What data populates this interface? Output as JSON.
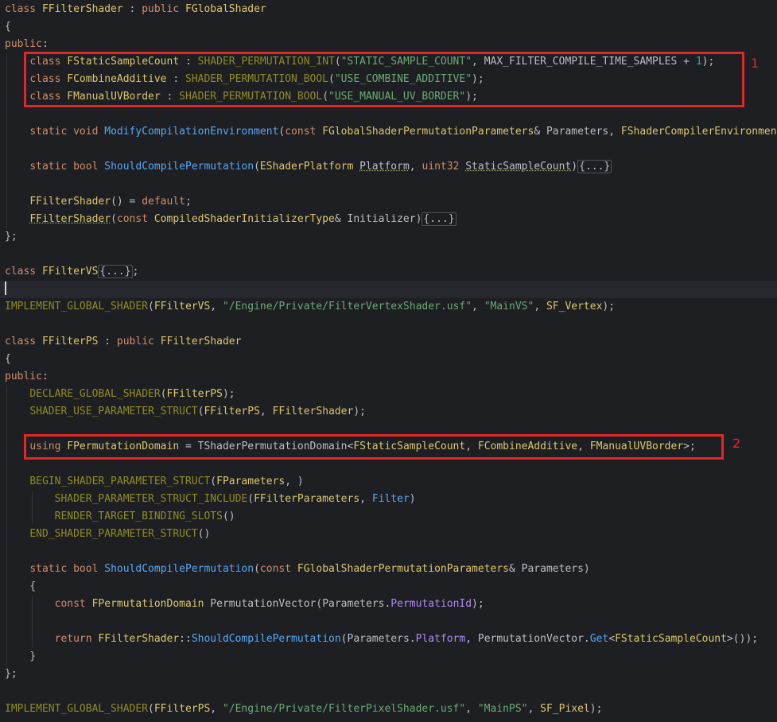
{
  "colors": {
    "background": "#1e1f22",
    "keyword": "#cf8e6d",
    "class_name": "#dcc76e",
    "function_name": "#56a8f5",
    "macro": "#908b25",
    "string": "#6aab73",
    "number": "#2aacb8",
    "parameter": "#b189f5",
    "plain": "#bcbec4",
    "annotation_red": "#e32626"
  },
  "annotations": [
    "1",
    "2"
  ],
  "code_lines": [
    {
      "tokens": [
        {
          "t": "class",
          "c": "kw"
        },
        {
          "t": " "
        },
        {
          "t": "FFilterShader",
          "c": "cls"
        },
        {
          "t": " : "
        },
        {
          "t": "public",
          "c": "kw"
        },
        {
          "t": " "
        },
        {
          "t": "FGlobalShader",
          "c": "cls"
        }
      ]
    },
    {
      "tokens": [
        {
          "t": "{"
        }
      ]
    },
    {
      "tokens": [
        {
          "t": "public",
          "c": "kw"
        },
        {
          "t": ":"
        }
      ]
    },
    {
      "tokens": [
        {
          "t": "    "
        },
        {
          "t": "class",
          "c": "kw"
        },
        {
          "t": " "
        },
        {
          "t": "FStaticSampleCount",
          "c": "cls"
        },
        {
          "t": " : "
        },
        {
          "t": "SHADER_PERMUTATION_INT",
          "c": "mac"
        },
        {
          "t": "("
        },
        {
          "t": "\"STATIC_SAMPLE_COUNT\"",
          "c": "str"
        },
        {
          "t": ", "
        },
        {
          "t": "MAX_FILTER_COMPILE_TIME_SAMPLES"
        },
        {
          "t": " + "
        },
        {
          "t": "1",
          "c": "num"
        },
        {
          "t": ");"
        }
      ]
    },
    {
      "tokens": [
        {
          "t": "    "
        },
        {
          "t": "class",
          "c": "kw"
        },
        {
          "t": " "
        },
        {
          "t": "FCombineAdditive",
          "c": "cls"
        },
        {
          "t": " : "
        },
        {
          "t": "SHADER_PERMUTATION_BOOL",
          "c": "mac"
        },
        {
          "t": "("
        },
        {
          "t": "\"USE_COMBINE_ADDITIVE\"",
          "c": "str"
        },
        {
          "t": ");"
        }
      ]
    },
    {
      "tokens": [
        {
          "t": "    "
        },
        {
          "t": "class",
          "c": "kw"
        },
        {
          "t": " "
        },
        {
          "t": "FManualUVBorder",
          "c": "cls"
        },
        {
          "t": " : "
        },
        {
          "t": "SHADER_PERMUTATION_BOOL",
          "c": "mac"
        },
        {
          "t": "("
        },
        {
          "t": "\"USE_MANUAL_UV_BORDER\"",
          "c": "str"
        },
        {
          "t": ");"
        }
      ]
    },
    {
      "tokens": []
    },
    {
      "tokens": [
        {
          "t": "    "
        },
        {
          "t": "static",
          "c": "kw"
        },
        {
          "t": " "
        },
        {
          "t": "void",
          "c": "kw"
        },
        {
          "t": " "
        },
        {
          "t": "ModifyCompilationEnvironment",
          "c": "fn"
        },
        {
          "t": "("
        },
        {
          "t": "const",
          "c": "kw"
        },
        {
          "t": " "
        },
        {
          "t": "FGlobalShaderPermutationParameters",
          "c": "cls"
        },
        {
          "t": "& Parameters, "
        },
        {
          "t": "FShaderCompilerEnvironment",
          "c": "cls"
        }
      ]
    },
    {
      "tokens": []
    },
    {
      "tokens": [
        {
          "t": "    "
        },
        {
          "t": "static",
          "c": "kw"
        },
        {
          "t": " "
        },
        {
          "t": "bool",
          "c": "kw"
        },
        {
          "t": " "
        },
        {
          "t": "ShouldCompilePermutation",
          "c": "fn"
        },
        {
          "t": "("
        },
        {
          "t": "EShaderPlatform",
          "c": "cls"
        },
        {
          "t": " "
        },
        {
          "t": "Platform",
          "u": true
        },
        {
          "t": ", "
        },
        {
          "t": "uint32",
          "c": "kw"
        },
        {
          "t": " "
        },
        {
          "t": "StaticSampleCount",
          "u": true
        },
        {
          "t": ")"
        },
        {
          "t": "{...}",
          "c": "fold"
        }
      ]
    },
    {
      "tokens": []
    },
    {
      "tokens": [
        {
          "t": "    "
        },
        {
          "t": "FFilterShader",
          "c": "cls"
        },
        {
          "t": "() = "
        },
        {
          "t": "default",
          "c": "kw"
        },
        {
          "t": ";"
        }
      ]
    },
    {
      "tokens": [
        {
          "t": "    "
        },
        {
          "t": "FFilterShader",
          "c": "cls",
          "u": true
        },
        {
          "t": "("
        },
        {
          "t": "const",
          "c": "kw"
        },
        {
          "t": " "
        },
        {
          "t": "CompiledShaderInitializerType",
          "c": "cls"
        },
        {
          "t": "& Initializer)"
        },
        {
          "t": "{...}",
          "c": "fold"
        }
      ]
    },
    {
      "tokens": [
        {
          "t": "};"
        }
      ]
    },
    {
      "tokens": []
    },
    {
      "tokens": [
        {
          "t": "class",
          "c": "kw"
        },
        {
          "t": " "
        },
        {
          "t": "FFilterVS",
          "c": "cls"
        },
        {
          "t": "{...}",
          "c": "fold"
        },
        {
          "t": ";"
        }
      ]
    },
    {
      "tokens": [],
      "current": true
    },
    {
      "tokens": [
        {
          "t": "IMPLEMENT_GLOBAL_SHADER",
          "c": "mac"
        },
        {
          "t": "("
        },
        {
          "t": "FFilterVS",
          "c": "cls"
        },
        {
          "t": ", "
        },
        {
          "t": "\"/Engine/Private/FilterVertexShader.usf\"",
          "c": "str"
        },
        {
          "t": ", "
        },
        {
          "t": "\"MainVS\"",
          "c": "str"
        },
        {
          "t": ", "
        },
        {
          "t": "SF_Vertex",
          "c": "cls"
        },
        {
          "t": ");"
        }
      ]
    },
    {
      "tokens": []
    },
    {
      "tokens": [
        {
          "t": "class",
          "c": "kw"
        },
        {
          "t": " "
        },
        {
          "t": "FFilterPS",
          "c": "cls"
        },
        {
          "t": " : "
        },
        {
          "t": "public",
          "c": "kw"
        },
        {
          "t": " "
        },
        {
          "t": "FFilterShader",
          "c": "cls"
        }
      ]
    },
    {
      "tokens": [
        {
          "t": "{"
        }
      ]
    },
    {
      "tokens": [
        {
          "t": "public",
          "c": "kw"
        },
        {
          "t": ":"
        }
      ]
    },
    {
      "tokens": [
        {
          "t": "    "
        },
        {
          "t": "DECLARE_GLOBAL_SHADER",
          "c": "mac"
        },
        {
          "t": "("
        },
        {
          "t": "FFilterPS",
          "c": "cls"
        },
        {
          "t": ");"
        }
      ]
    },
    {
      "tokens": [
        {
          "t": "    "
        },
        {
          "t": "SHADER_USE_PARAMETER_STRUCT",
          "c": "mac"
        },
        {
          "t": "("
        },
        {
          "t": "FFilterPS",
          "c": "cls"
        },
        {
          "t": ", "
        },
        {
          "t": "FFilterShader",
          "c": "cls"
        },
        {
          "t": ");"
        }
      ]
    },
    {
      "tokens": []
    },
    {
      "tokens": [
        {
          "t": "    "
        },
        {
          "t": "using",
          "c": "kw"
        },
        {
          "t": " "
        },
        {
          "t": "FPermutationDomain",
          "c": "cls"
        },
        {
          "t": " = "
        },
        {
          "t": "TShaderPermutationDomain"
        },
        {
          "t": "<"
        },
        {
          "t": "FStaticSampleCount",
          "c": "cls"
        },
        {
          "t": ", "
        },
        {
          "t": "FCombineAdditive",
          "c": "cls"
        },
        {
          "t": ", "
        },
        {
          "t": "FManualUVBorder",
          "c": "cls"
        },
        {
          "t": ">;"
        }
      ]
    },
    {
      "tokens": []
    },
    {
      "tokens": [
        {
          "t": "    "
        },
        {
          "t": "BEGIN_SHADER_PARAMETER_STRUCT",
          "c": "mac"
        },
        {
          "t": "("
        },
        {
          "t": "FParameters",
          "c": "cls"
        },
        {
          "t": ", )"
        }
      ]
    },
    {
      "tokens": [
        {
          "t": "        "
        },
        {
          "t": "SHADER_PARAMETER_STRUCT_INCLUDE",
          "c": "mac"
        },
        {
          "t": "("
        },
        {
          "t": "FFilterParameters",
          "c": "cls"
        },
        {
          "t": ", "
        },
        {
          "t": "Filter",
          "c": "fn"
        },
        {
          "t": ")"
        }
      ]
    },
    {
      "tokens": [
        {
          "t": "        "
        },
        {
          "t": "RENDER_TARGET_BINDING_SLOTS",
          "c": "mac"
        },
        {
          "t": "()"
        }
      ]
    },
    {
      "tokens": [
        {
          "t": "    "
        },
        {
          "t": "END_SHADER_PARAMETER_STRUCT",
          "c": "mac"
        },
        {
          "t": "()"
        }
      ]
    },
    {
      "tokens": []
    },
    {
      "tokens": [
        {
          "t": "    "
        },
        {
          "t": "static",
          "c": "kw"
        },
        {
          "t": " "
        },
        {
          "t": "bool",
          "c": "kw"
        },
        {
          "t": " "
        },
        {
          "t": "ShouldCompilePermutation",
          "c": "fn"
        },
        {
          "t": "("
        },
        {
          "t": "const",
          "c": "kw"
        },
        {
          "t": " "
        },
        {
          "t": "FGlobalShaderPermutationParameters",
          "c": "cls"
        },
        {
          "t": "& Parameters)"
        }
      ]
    },
    {
      "tokens": [
        {
          "t": "    {"
        }
      ]
    },
    {
      "tokens": [
        {
          "t": "        "
        },
        {
          "t": "const",
          "c": "kw"
        },
        {
          "t": " "
        },
        {
          "t": "FPermutationDomain",
          "c": "cls"
        },
        {
          "t": " PermutationVector("
        },
        {
          "t": "Parameters.",
          "c": "plain"
        },
        {
          "t": "PermutationId",
          "c": "par"
        },
        {
          "t": ");"
        }
      ]
    },
    {
      "tokens": []
    },
    {
      "tokens": [
        {
          "t": "        "
        },
        {
          "t": "return",
          "c": "kw"
        },
        {
          "t": " "
        },
        {
          "t": "FFilterShader",
          "c": "cls"
        },
        {
          "t": "::"
        },
        {
          "t": "ShouldCompilePermutation",
          "c": "fn"
        },
        {
          "t": "(Parameters."
        },
        {
          "t": "Platform",
          "c": "par"
        },
        {
          "t": ", PermutationVector."
        },
        {
          "t": "Get",
          "c": "fn"
        },
        {
          "t": "<"
        },
        {
          "t": "FStaticSampleCount",
          "c": "cls"
        },
        {
          "t": ">());"
        }
      ]
    },
    {
      "tokens": [
        {
          "t": "    }"
        }
      ]
    },
    {
      "tokens": [
        {
          "t": "};"
        }
      ]
    },
    {
      "tokens": []
    },
    {
      "tokens": [
        {
          "t": "IMPLEMENT_GLOBAL_SHADER",
          "c": "mac"
        },
        {
          "t": "("
        },
        {
          "t": "FFilterPS",
          "c": "cls"
        },
        {
          "t": ", "
        },
        {
          "t": "\"/Engine/Private/FilterPixelShader.usf\"",
          "c": "str"
        },
        {
          "t": ", "
        },
        {
          "t": "\"MainPS\"",
          "c": "str"
        },
        {
          "t": ", "
        },
        {
          "t": "SF_Pixel",
          "c": "cls"
        },
        {
          "t": ");"
        }
      ]
    }
  ]
}
